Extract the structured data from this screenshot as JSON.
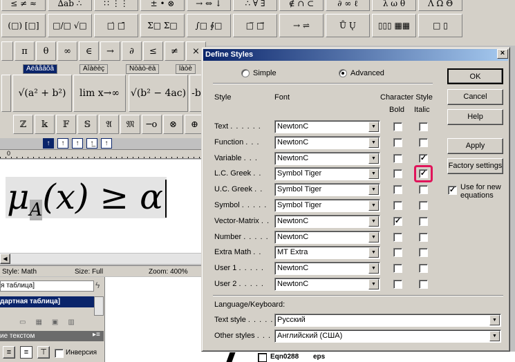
{
  "palette_row1": [
    "≤ ≠ ≈",
    "∆ab ∴",
    "∷ ⋮⋮",
    "± • ⊗",
    "→ ⇔ ↓",
    "∴ ∀ ∃",
    "∉ ∩ ⊂",
    "∂ ∞ ℓ",
    "λ ω θ",
    "Λ Ω Θ"
  ],
  "palette_row2": [
    "(□) [□]",
    "□/□ √□",
    "□̇ □̄",
    "Σ□ Σ□",
    "∫□ ∮□",
    "□̅ □⃗",
    "→ ⇌",
    "Ů Ų",
    "▯▯▯ ▦▦",
    "□ ▯"
  ],
  "palette_row3": [
    "π",
    "θ",
    "∞",
    "∈",
    "→",
    "∂",
    "≤",
    "≠",
    "×"
  ],
  "tabs": [
    "Aëâåâõâ",
    "Aîàëèç",
    "Nòàò-ëà",
    "làòè"
  ],
  "templates": [
    "√(a² + b²)",
    "lim x→∞",
    "√(b² − 4ac)",
    "-b"
  ],
  "palette_row4": [
    "ℤ",
    "𝕜",
    "𝔽",
    "𝕊",
    "𝔄",
    "𝔐",
    "─o",
    "⊗",
    "⊕"
  ],
  "size_buttons": [
    "↑",
    "↑",
    "↑",
    "↑̲",
    "↑"
  ],
  "ruler_zero": "0",
  "equation": {
    "mu": "μ",
    "sub": "A",
    "rest": "(x) ≥ α"
  },
  "status": {
    "style": "Style: Math",
    "size": "Size: Full",
    "zoom": "Zoom: 400%"
  },
  "panel": {
    "item1": "я таблица]",
    "item2": "дартная таблица]",
    "text_panel_title": "ие текстом",
    "checkbox_label": "Инверсия"
  },
  "bg_file": {
    "name": "Eqn0288",
    "type": "eps"
  },
  "dialog": {
    "title": "Define Styles",
    "close": "×",
    "mode_simple": "Simple",
    "mode_advanced": "Advanced",
    "col_style": "Style",
    "col_font": "Font",
    "col_charstyle": "Character Style",
    "col_bold": "Bold",
    "col_italic": "Italic",
    "rows": [
      {
        "label": "Text",
        "font": "NewtonC",
        "bold": false,
        "italic": false
      },
      {
        "label": "Function",
        "font": "NewtonC",
        "bold": false,
        "italic": false
      },
      {
        "label": "Variable",
        "font": "NewtonC",
        "bold": false,
        "italic": true
      },
      {
        "label": "L.C. Greek",
        "font": "Symbol Tiger",
        "bold": false,
        "italic": true
      },
      {
        "label": "U.C. Greek",
        "font": "Symbol Tiger",
        "bold": false,
        "italic": false
      },
      {
        "label": "Symbol",
        "font": "Symbol Tiger",
        "bold": false,
        "italic": false
      },
      {
        "label": "Vector-Matrix",
        "font": "NewtonC",
        "bold": true,
        "italic": false
      },
      {
        "label": "Number",
        "font": "NewtonC",
        "bold": false,
        "italic": false
      },
      {
        "label": "Extra Math",
        "font": "MT Extra",
        "bold": false,
        "italic": false
      },
      {
        "label": "User 1",
        "font": "NewtonC",
        "bold": false,
        "italic": false
      },
      {
        "label": "User 2",
        "font": "NewtonC",
        "bold": false,
        "italic": false
      }
    ],
    "lang_title": "Language/Keyboard:",
    "text_style_label": "Text style",
    "text_style_value": "Русский",
    "other_styles_label": "Other styles",
    "other_styles_value": "Английский (США)",
    "btn_ok": "OK",
    "btn_cancel": "Cancel",
    "btn_help": "Help",
    "btn_apply": "Apply",
    "btn_factory": "Factory settings",
    "use_new_label": "Use for new equations",
    "use_new_checked": true
  },
  "colors": {
    "highlight": "#e0145a",
    "title_bar": "#0a246a"
  }
}
